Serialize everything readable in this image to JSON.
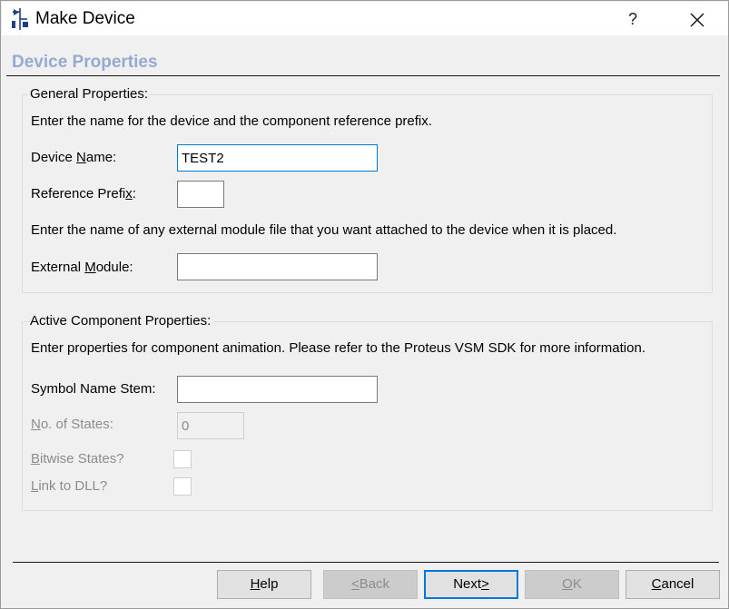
{
  "window": {
    "title": "Make Device",
    "help_glyph": "?",
    "icon": "device-icon"
  },
  "page": {
    "header": "Device Properties"
  },
  "general": {
    "legend": "General Properties:",
    "intro": "Enter the name for the device and the component reference prefix.",
    "device_name": {
      "label_pre": "Device ",
      "label_ul": "N",
      "label_post": "ame:",
      "value": "TEST2"
    },
    "reference_prefix": {
      "label_pre": "Reference Prefi",
      "label_ul": "x",
      "label_post": ":",
      "value": ""
    },
    "external_intro": "Enter the name of any external module file that you want attached to the device when it is placed.",
    "external_module": {
      "label_pre": "External ",
      "label_ul": "M",
      "label_post": "odule:",
      "value": ""
    }
  },
  "active": {
    "legend": "Active Component Properties:",
    "intro": "Enter properties for component animation. Please refer to the Proteus VSM SDK for more information.",
    "symbol_name_stem": {
      "label": "Symbol Name Stem:",
      "value": ""
    },
    "num_states": {
      "label_ul": "N",
      "label_post": "o. of States:",
      "value": "0",
      "enabled": false
    },
    "bitwise_states": {
      "label_ul": "B",
      "label_post": "itwise States?",
      "checked": false,
      "enabled": false
    },
    "link_to_dll": {
      "label_ul": "L",
      "label_post": "ink to DLL?",
      "checked": false,
      "enabled": false
    }
  },
  "buttons": {
    "help": {
      "ul": "H",
      "post": "elp",
      "enabled": true
    },
    "back": {
      "pre": "",
      "ul": "<",
      "post": "Back",
      "enabled": false
    },
    "next": {
      "pre": "Next",
      "ul": ">",
      "post": "",
      "enabled": true,
      "default": true
    },
    "ok": {
      "pre": "",
      "ul": "O",
      "post": "K",
      "enabled": false
    },
    "cancel": {
      "ul": "C",
      "post": "ancel",
      "enabled": true
    }
  },
  "colors": {
    "header_text": "#94aad0",
    "focus_border": "#0078d7",
    "disabled_text": "#8c8c8c",
    "dialog_bg": "#f0f0f0"
  }
}
